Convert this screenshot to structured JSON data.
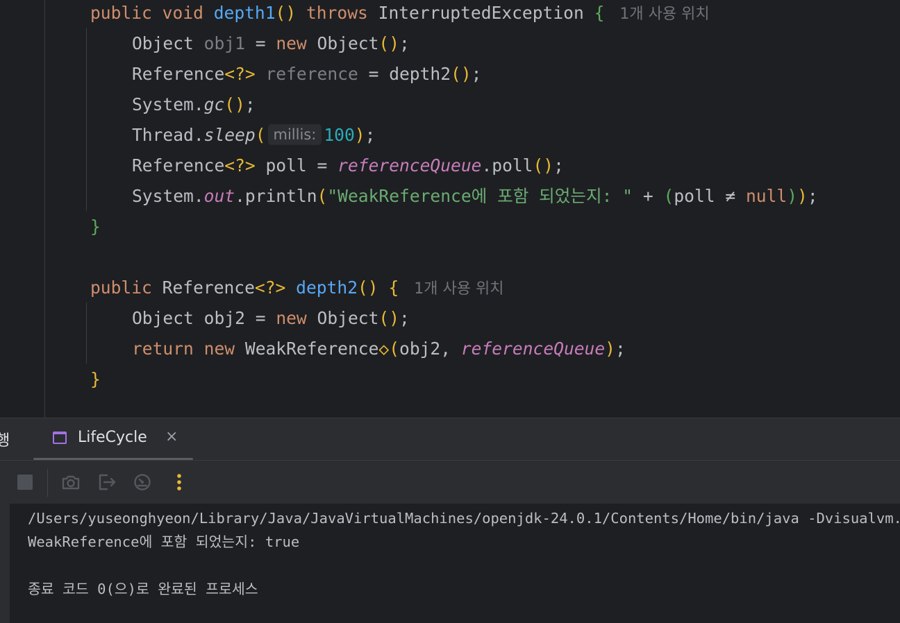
{
  "editor": {
    "usages_label": "1개 사용 위치",
    "depth1": {
      "public": "public",
      "void": "void",
      "name": "depth1",
      "throws": "throws",
      "exception": "InterruptedException"
    },
    "l1": {
      "type": "Object",
      "var": "obj1",
      "new": "new",
      "ctor": "Object"
    },
    "l2": {
      "type": "Reference",
      "generic": "<?>",
      "var": "reference",
      "call": "depth2"
    },
    "l3": {
      "cls": "System",
      "method": "gc"
    },
    "l4": {
      "cls": "Thread",
      "method": "sleep",
      "hint": "millis:",
      "arg": "100"
    },
    "l5": {
      "type": "Reference",
      "generic": "<?>",
      "var": "poll",
      "field": "referenceQueue",
      "method": "poll"
    },
    "l6": {
      "cls": "System",
      "field": "out",
      "method": "println",
      "string": "\"WeakReference에 포함 되었는지: \"",
      "plus": "+",
      "var": "poll",
      "neq": "≠",
      "null": "null"
    },
    "depth2": {
      "public": "public",
      "type": "Reference",
      "generic": "<?>",
      "name": "depth2"
    },
    "l7": {
      "type": "Object",
      "var": "obj2",
      "new": "new",
      "ctor": "Object"
    },
    "l8": {
      "return": "return",
      "new": "new",
      "cls": "WeakReference",
      "diamond": "◇",
      "arg1": "obj2",
      "field": "referenceQueue"
    }
  },
  "run_panel": {
    "label": "행",
    "tab_label": "LifeCycle",
    "tab_close": "×",
    "toolbar": {
      "stop": "stop-icon",
      "screenshot": "camera-icon",
      "exit": "exit-icon",
      "profiler": "gauge-icon",
      "more": "more-icon"
    },
    "accent": "#a571e6"
  },
  "console": {
    "lines": [
      "/Users/yuseonghyeon/Library/Java/JavaVirtualMachines/openjdk-24.0.1/Contents/Home/bin/java -Dvisualvm.id=",
      "WeakReference에 포함 되었는지: true",
      "",
      "종료 코드 0(으)로 완료된 프로세스"
    ]
  }
}
